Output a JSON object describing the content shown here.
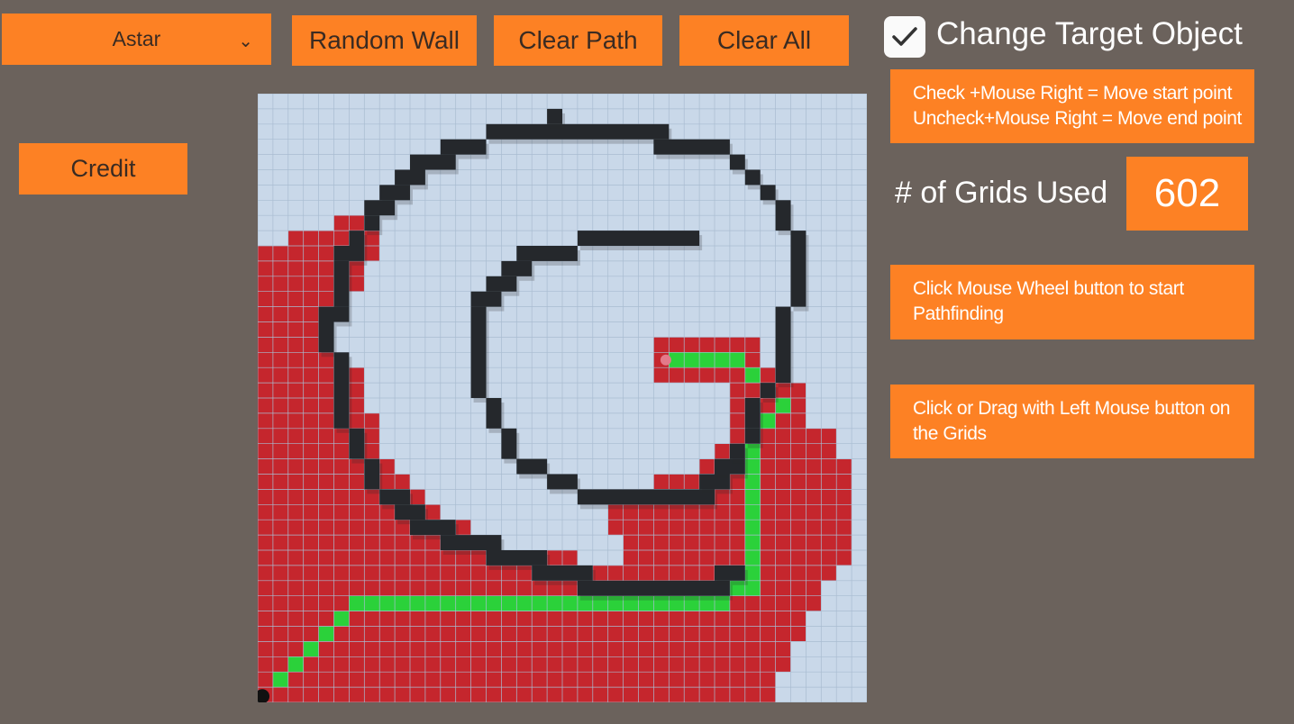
{
  "toolbar": {
    "algorithm": {
      "selected": "Astar"
    },
    "random_wall_label": "Random Wall",
    "clear_path_label": "Clear Path",
    "clear_all_label": "Clear All",
    "credit_label": "Credit"
  },
  "target_toggle": {
    "checked": true,
    "label": "Change Target Object"
  },
  "instructions": {
    "move_points": [
      "Check +Mouse Right = Move start point",
      "Uncheck+Mouse Right = Move end point"
    ],
    "pathfinding": [
      "Click Mouse Wheel button to start",
      "Pathfinding"
    ],
    "drawing": [
      "Click or Drag with Left Mouse button on",
      "the Grids"
    ]
  },
  "stats": {
    "grids_used_label": "# of Grids Used",
    "grids_used_value": "602"
  },
  "grid": {
    "columns": 40,
    "rows": 40,
    "colors": {
      "empty": "#c9d8e9",
      "line": "#a9bcd1",
      "visited": "#c5262d",
      "path": "#2bd13a",
      "wall": "#25282c",
      "start": "#111111",
      "end": "#e37a8a"
    }
  }
}
